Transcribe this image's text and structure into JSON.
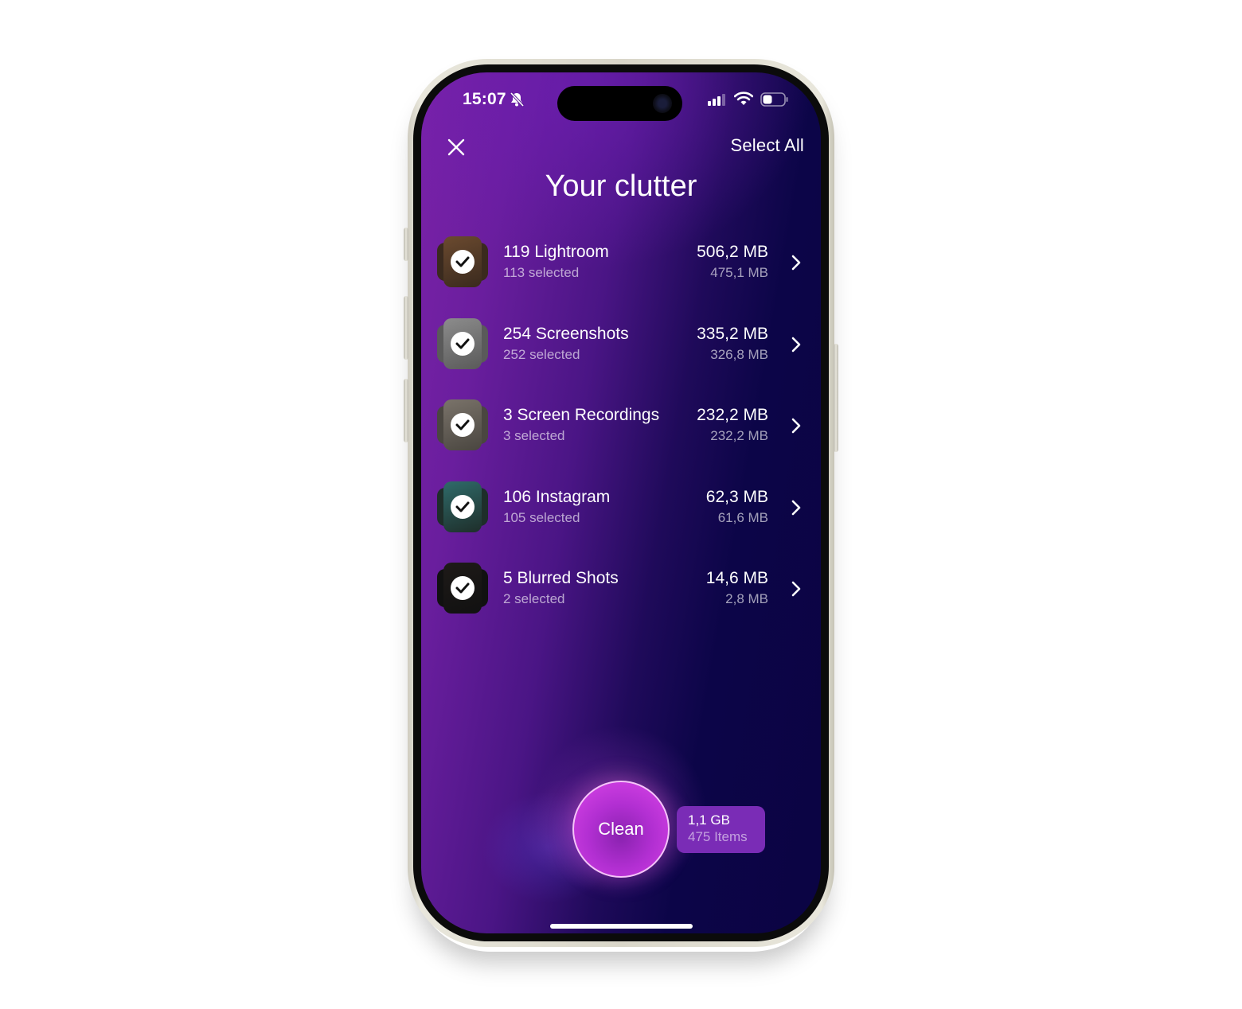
{
  "status_bar": {
    "time": "15:07",
    "silent_icon": "bell-slash-icon",
    "signal_icon": "cellular-signal-icon",
    "wifi_icon": "wifi-icon",
    "battery_icon": "battery-icon",
    "battery_level": 0.35
  },
  "header": {
    "close_icon": "close-icon",
    "select_all_label": "Select All",
    "title": "Your clutter"
  },
  "categories": [
    {
      "title": "119 Lightroom",
      "selected": "113 selected",
      "total_size": "506,2 MB",
      "selected_size": "475,1 MB",
      "checked": true,
      "thumb_colors": [
        "#3a2a1e",
        "#6b4a2f"
      ]
    },
    {
      "title": "254 Screenshots",
      "selected": "252 selected",
      "total_size": "335,2 MB",
      "selected_size": "326,8 MB",
      "checked": true,
      "thumb_colors": [
        "#5a5a5a",
        "#8c8c8c"
      ]
    },
    {
      "title": "3 Screen Recordings",
      "selected": "3 selected",
      "total_size": "232,2 MB",
      "selected_size": "232,2 MB",
      "checked": true,
      "thumb_colors": [
        "#4a4640",
        "#7a736a"
      ]
    },
    {
      "title": "106 Instagram",
      "selected": "105 selected",
      "total_size": "62,3 MB",
      "selected_size": "61,6 MB",
      "checked": true,
      "thumb_colors": [
        "#1e2e2a",
        "#2f6b6a"
      ]
    },
    {
      "title": "5 Blurred Shots",
      "selected": "2 selected",
      "total_size": "14,6 MB",
      "selected_size": "2,8 MB",
      "checked": true,
      "thumb_colors": [
        "#111111",
        "#1e1a18"
      ]
    }
  ],
  "footer": {
    "clean_label": "Clean",
    "summary_size": "1,1 GB",
    "summary_items": "475 Items"
  },
  "colors": {
    "accent": "#c53ad9",
    "badge": "#7a2cb6",
    "background_start": "#7a22a8",
    "background_end": "#0b0443"
  }
}
